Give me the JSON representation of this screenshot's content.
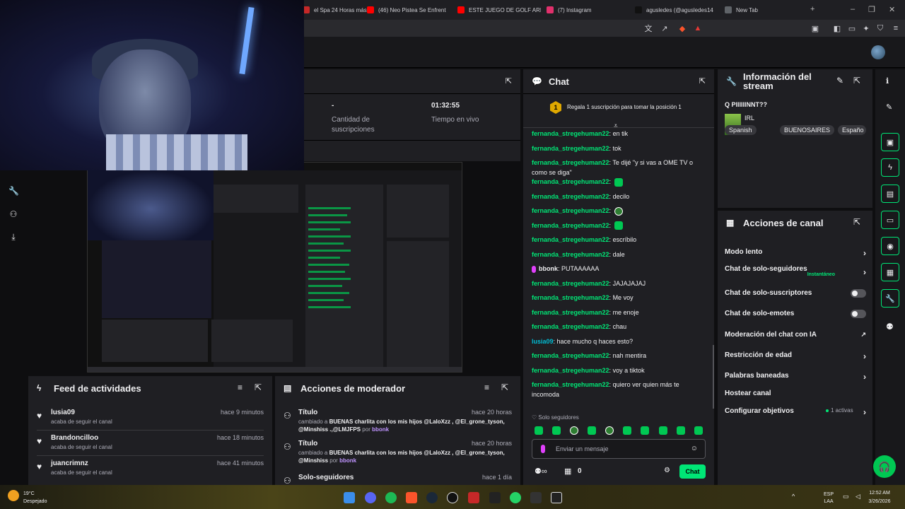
{
  "browser": {
    "tabs": [
      {
        "title": "el Spa 24 Horas más",
        "color": "#c62828"
      },
      {
        "title": "(46) Neo Pistea Se Enfrent",
        "color": "#ff0000"
      },
      {
        "title": "ESTE JUEGO DE GOLF ARR",
        "color": "#ff0000"
      },
      {
        "title": "(7) Instagram",
        "color": "#e1306c"
      },
      {
        "title": "agusledes (@agusledes14",
        "color": "#111111"
      },
      {
        "title": "New Tab",
        "color": "#5f6368"
      }
    ]
  },
  "stats": {
    "subs_value": "-",
    "subs_label": "Cantidad de suscripciones",
    "live_value": "01:32:55",
    "live_label": "Tiempo en vivo"
  },
  "feed": {
    "title": "Feed de actividades",
    "items": [
      {
        "name": "lusia09",
        "sub": "acaba de seguir el canal",
        "time": "hace 9 minutos"
      },
      {
        "name": "Brandoncilloo",
        "sub": "acaba de seguir el canal",
        "time": "hace 18 minutos"
      },
      {
        "name": "juancrimnz",
        "sub": "acaba de seguir el canal",
        "time": "hace 41 minutos"
      }
    ]
  },
  "mod": {
    "title": "Acciones de moderador",
    "items": [
      {
        "name": "Título",
        "time": "hace 20 horas",
        "prefix": "cambiado a",
        "text": "BUENAS charlita con los mis hijos @LaloXzz , @El_grone_tyson, @Minshiss .,@LMJFPS",
        "by": "bbonk"
      },
      {
        "name": "Título",
        "time": "hace 20 horas",
        "prefix": "cambiado a",
        "text": "BUENAS charlita con los mis hijos @LaloXzz , @El_grone_tyson, @Minshiss",
        "by": "bbonk"
      },
      {
        "name": "Solo-seguidores",
        "time": "hace 1 día"
      }
    ],
    "por": "por"
  },
  "chat": {
    "title": "Chat",
    "gift_text": "Regala 1 suscripción para tomar la posición 1",
    "gift_rank": "1",
    "messages": [
      {
        "user": "fernanda_stregehuman22",
        "text": "en tik",
        "style": "u"
      },
      {
        "user": "fernanda_stregehuman22",
        "text": "tok",
        "style": "u"
      },
      {
        "user": "fernanda_stregehuman22",
        "text": "Te dijé \"y si vas a OME TV o como se diga\"",
        "style": "u"
      },
      {
        "user": "fernanda_stregehuman22",
        "text": "",
        "style": "u",
        "emote": "square"
      },
      {
        "user": "fernanda_stregehuman22",
        "text": "decilo",
        "style": "u"
      },
      {
        "user": "fernanda_stregehuman22",
        "text": "",
        "style": "u",
        "emote": "round"
      },
      {
        "user": "fernanda_stregehuman22",
        "text": "",
        "style": "u",
        "emote": "square"
      },
      {
        "user": "fernanda_stregehuman22",
        "text": "escríbilo",
        "style": "u"
      },
      {
        "user": "fernanda_stregehuman22",
        "text": "dale",
        "style": "u"
      },
      {
        "user": "bbonk",
        "text": "PUTAAAAAA",
        "style": "u3"
      },
      {
        "user": "fernanda_stregehuman22",
        "text": "JAJAJAJAJ",
        "style": "u"
      },
      {
        "user": "fernanda_stregehuman22",
        "text": "Me voy",
        "style": "u"
      },
      {
        "user": "fernanda_stregehuman22",
        "text": "me enoje",
        "style": "u"
      },
      {
        "user": "fernanda_stregehuman22",
        "text": "chau",
        "style": "u"
      },
      {
        "user": "lusia09",
        "text": "hace mucho q haces esto?",
        "style": "u2"
      },
      {
        "user": "fernanda_stregehuman22",
        "text": "nah mentira",
        "style": "u"
      },
      {
        "user": "fernanda_stregehuman22",
        "text": "voy a tiktok",
        "style": "u"
      },
      {
        "user": "fernanda_stregehuman22",
        "text": "quiero ver quien más te incomoda",
        "style": "u"
      }
    ],
    "mode_label": "Solo seguidores",
    "input_placeholder": "Enviar un mensaje",
    "points": "0",
    "send_label": "Chat"
  },
  "info": {
    "title": "Información del stream",
    "stream_title": "Q PIIIIIINNT??",
    "category": "IRL",
    "tags": [
      "Spanish",
      "BUENOSAIRES",
      "Españo"
    ]
  },
  "actions": {
    "title": "Acciones de canal",
    "rows": [
      {
        "label": "Modo lento",
        "kind": "chev"
      },
      {
        "label": "Chat de solo-seguidores",
        "sub": "Instantáneo",
        "kind": "chev"
      },
      {
        "label": "Chat de solo-suscriptores",
        "kind": "toggle"
      },
      {
        "label": "Chat de solo-emotes",
        "kind": "toggle"
      },
      {
        "label": "Moderación del chat con IA",
        "kind": "ext"
      },
      {
        "label": "Restricción de edad",
        "kind": "chev"
      },
      {
        "label": "Palabras baneadas",
        "kind": "chev"
      },
      {
        "label": "Hostear canal",
        "kind": "none"
      },
      {
        "label": "Configurar objetivos",
        "kind": "goal",
        "extra": "1 activas"
      }
    ]
  },
  "taskbar": {
    "weather_temp": "19°C",
    "weather_desc": "Despejado",
    "lang_top": "ESP",
    "lang_bottom": "LAA",
    "time": "12:52 AM",
    "date": "3/26/2026"
  }
}
